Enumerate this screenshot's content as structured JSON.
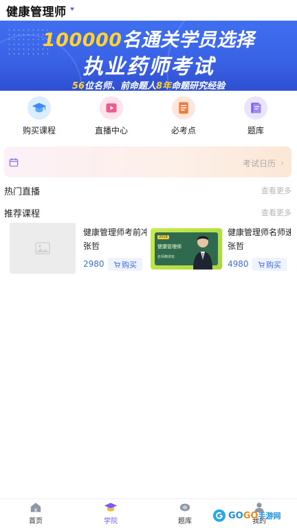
{
  "header": {
    "title": "健康管理师"
  },
  "banner": {
    "line1_number": "100000",
    "line1_text": "名通关学员选择",
    "line2": "执业药师考试",
    "line3_a": "56",
    "line3_b": "位名师、前命题人",
    "line3_c": "8年",
    "line3_d": "命题研究经验"
  },
  "categories": [
    {
      "label": "购买课程",
      "icon": "graduation-cap-icon",
      "color": "#3d8cf0"
    },
    {
      "label": "直播中心",
      "icon": "play-icon",
      "color": "#f05a86"
    },
    {
      "label": "必考点",
      "icon": "document-icon",
      "color": "#f07a3a"
    },
    {
      "label": "题库",
      "icon": "book-icon",
      "color": "#7b5cf0"
    }
  ],
  "calendar": {
    "label": "考试日历",
    "arrow": "›"
  },
  "sections": {
    "live": {
      "title": "热门直播",
      "more": "查看更多"
    },
    "recommend": {
      "title": "推荐课程",
      "more": "查看更多"
    }
  },
  "courses": [
    {
      "title": "健康管理师考前冲刺",
      "teacher": "张哲",
      "price": "2980",
      "buy": "购买"
    },
    {
      "title": "健康管理师名师速成",
      "teacher": "张哲",
      "price": "4980",
      "buy": "购买",
      "thumb_badge": "2019",
      "thumb_text": "健康管理师",
      "thumb_sub": "名师精讲班"
    }
  ],
  "tabs": [
    {
      "label": "首页",
      "icon": "home-icon"
    },
    {
      "label": "学院",
      "icon": "graduation-cap-icon",
      "active": true
    },
    {
      "label": "题库",
      "icon": "question-bank-icon"
    },
    {
      "label": "我的",
      "icon": "profile-icon"
    }
  ],
  "watermark": {
    "brand_a": "GO",
    "brand_b": "GO",
    "suffix": "手游网"
  },
  "colors": {
    "accent": "#7b5cf0",
    "price": "#3b6de0",
    "banner": "#3a63e6",
    "highlight": "#ffd233"
  }
}
